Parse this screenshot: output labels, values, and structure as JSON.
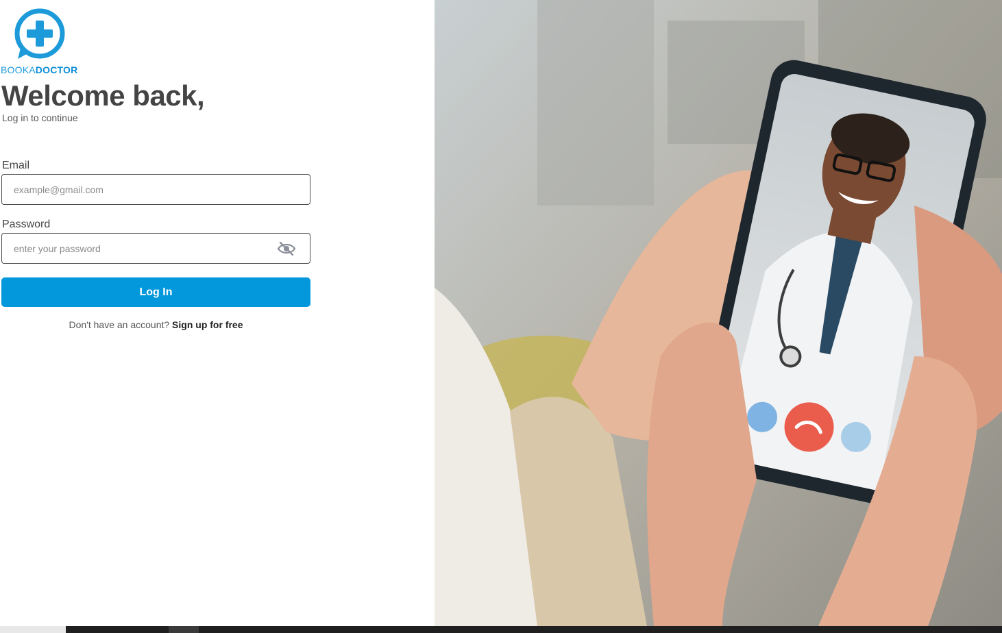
{
  "logo": {
    "text_light": "BOOKA",
    "text_bold": "DOCTOR",
    "brand_color": "#1d9ad9"
  },
  "heading": {
    "title": "Welcome back,",
    "subtitle": "Log in to continue"
  },
  "form": {
    "email_label": "Email",
    "email_placeholder": "example@gmail.com",
    "email_value": "",
    "password_label": "Password",
    "password_placeholder": "enter your password",
    "password_value": "",
    "login_label": "Log In",
    "login_color": "#0398dc",
    "signup_prompt": "Don't have an account? ",
    "signup_link": "Sign up for free"
  },
  "icons": {
    "logo": "medical-cross-chat-icon",
    "password_toggle": "eye-off-icon",
    "mute": "microphone-off-icon",
    "hangup": "phone-hangup-icon",
    "speaker": "speaker-icon"
  }
}
